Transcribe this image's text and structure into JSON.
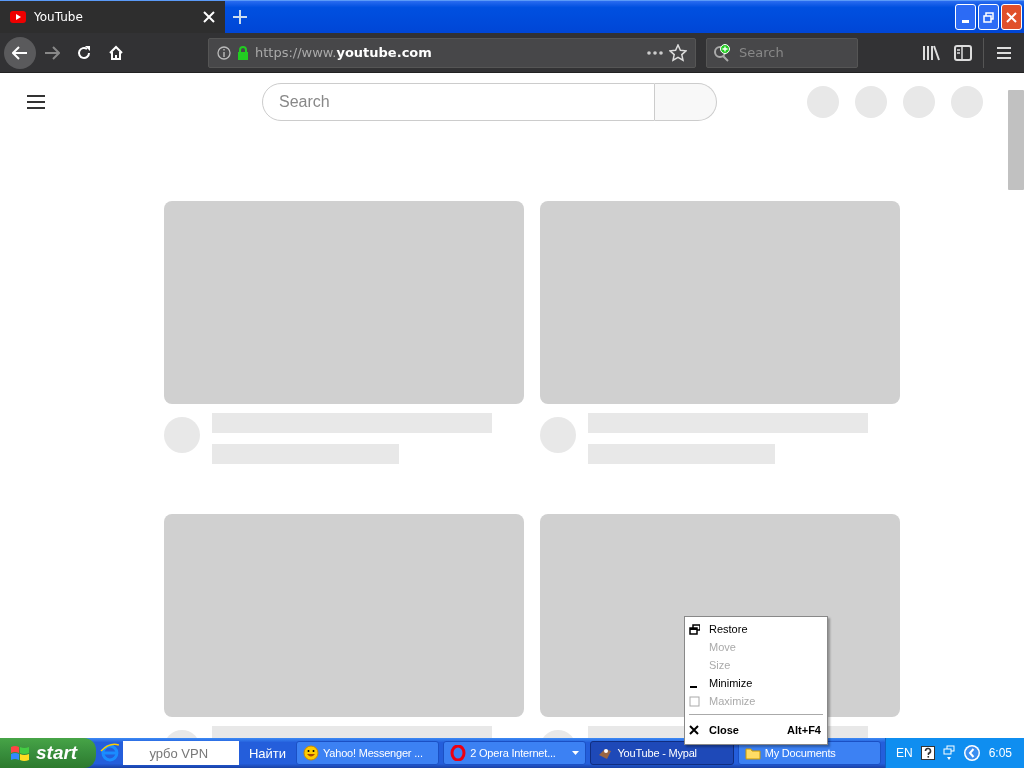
{
  "tabs": [
    {
      "label": "YouTube",
      "selected": true
    }
  ],
  "toolbar": {
    "url": "https://www.**youtube.com**",
    "search_placeholder": "Search"
  },
  "page": {
    "search": {
      "placeholder": "Search"
    },
    "videos": [
      {
        "kind": "loading"
      },
      {
        "kind": "loading"
      },
      {
        "kind": "loading"
      },
      {
        "kind": "loading"
      }
    ]
  },
  "context_menu": {
    "items": [
      {
        "kind": "restore",
        "label": "Restore",
        "disabled": false
      },
      {
        "kind": "none",
        "label": "Move",
        "disabled": true
      },
      {
        "kind": "none",
        "label": "Size",
        "disabled": true
      },
      {
        "kind": "minimize",
        "label": "Minimize",
        "disabled": false
      },
      {
        "kind": "maximize",
        "label": "Maximize",
        "disabled": true
      },
      {
        "kind": "separator"
      },
      {
        "kind": "close",
        "label": "Close",
        "shortcut": "Alt+F4",
        "disabled": false
      }
    ]
  },
  "taskbar": {
    "start": "start",
    "address": "урбо VPN",
    "go": "Найти",
    "tasks": [
      {
        "kind": "messenger",
        "label": "Yahoo! Messenger ...",
        "selected": false
      },
      {
        "kind": "browser-group",
        "label": "2 Opera Internet...",
        "selected": false
      },
      {
        "kind": "browser",
        "label": "YouTube - Mypal",
        "selected": true
      },
      {
        "kind": "folder",
        "label": "My Documents",
        "selected": false
      }
    ],
    "tray": {
      "language": "EN",
      "clock": "6:05"
    }
  }
}
